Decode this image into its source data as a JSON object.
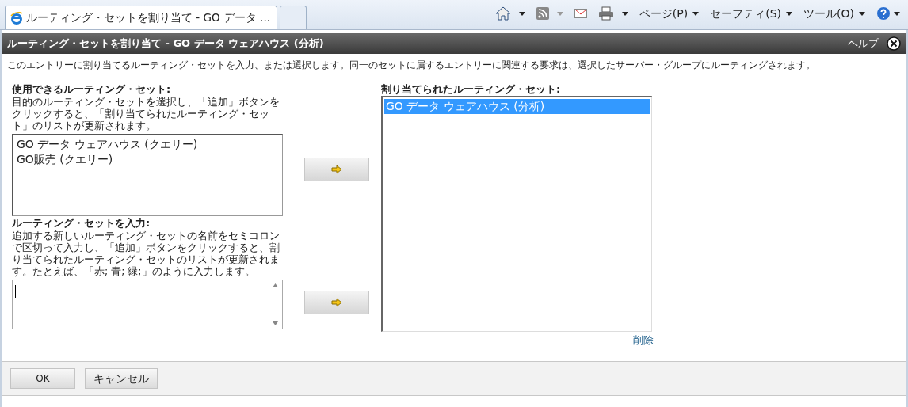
{
  "browser": {
    "tabs": [
      {
        "label": "ルーティング・セットを割り当て - GO データ ...",
        "selected": true
      },
      {
        "selected": false
      }
    ],
    "menus": [
      "ページ(P)",
      "セーフティ(S)",
      "ツール(O)"
    ]
  },
  "dialog": {
    "title": "ルーティング・セットを割り当て - GO データ ウェアハウス (分析)",
    "help": "ヘルプ",
    "description": "このエントリーに割り当てるルーティング・セットを入力、または選択します。同一のセットに属するエントリーに関連する要求は、選択したサーバー・グループにルーティングされます。",
    "available": {
      "label": "使用できるルーティング・セット:",
      "description": "目的のルーティング・セットを選択し、「追加」ボタンをクリックすると、「割り当てられたルーティング・セット」のリストが更新されます。",
      "items": [
        {
          "label": "GO データ ウェアハウス (クエリー)",
          "selected": false
        },
        {
          "label": "GO販売 (クエリー)",
          "selected": false
        }
      ]
    },
    "enter": {
      "label": "ルーティング・セットを入力:",
      "description": "追加する新しいルーティング・セットの名前をセミコロンで区切って入力し、「追加」ボタンをクリックすると、割り当てられたルーティング・セットのリストが更新されます。たとえば、「赤; 青; 緑;」のように入力します。"
    },
    "assigned": {
      "label": "割り当てられたルーティング・セット:",
      "items": [
        {
          "label": "GO データ ウェアハウス (分析)",
          "selected": true
        }
      ],
      "delete": "削除"
    },
    "buttons": [
      "OK",
      "キャンセル"
    ]
  }
}
